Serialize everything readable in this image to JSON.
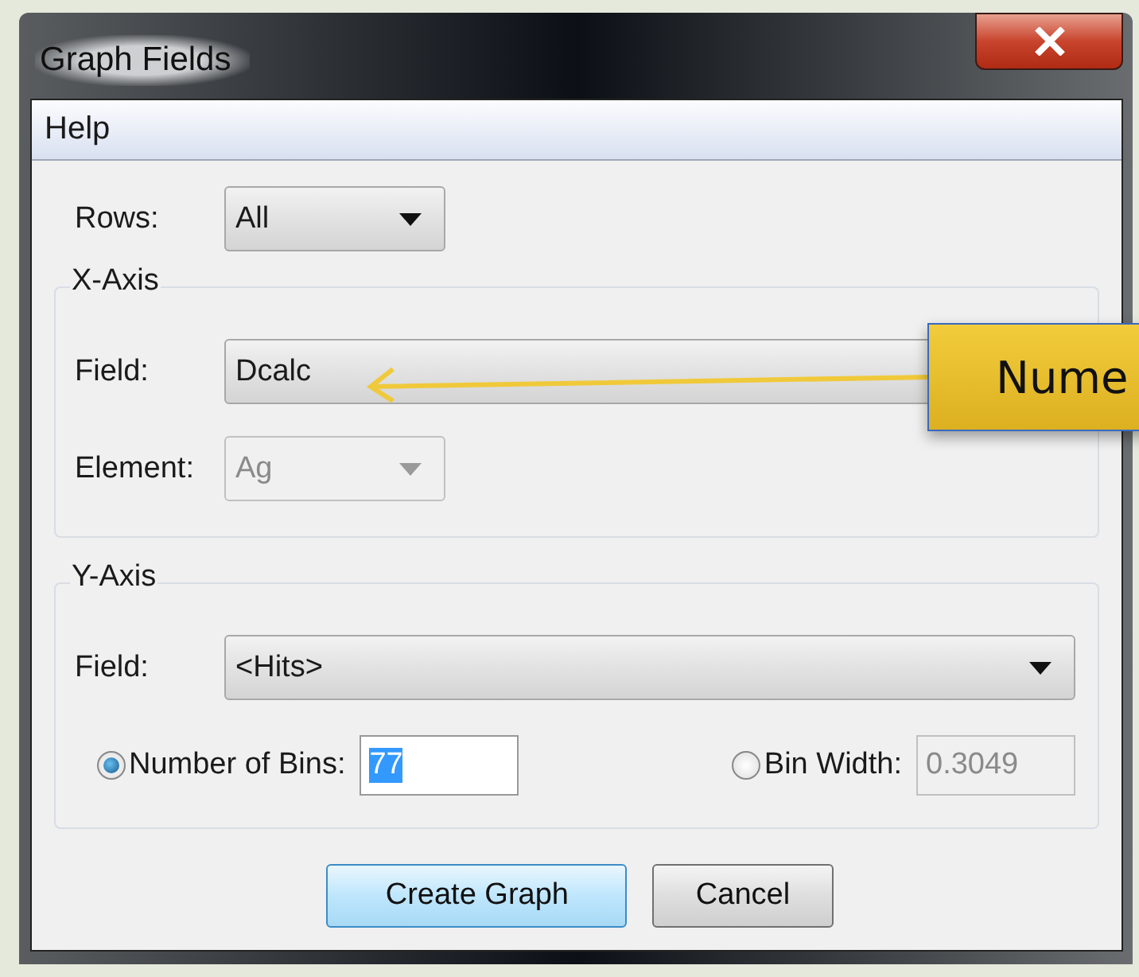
{
  "window": {
    "title": "Graph Fields"
  },
  "menu": [
    {
      "label": "Help"
    }
  ],
  "rows": {
    "label": "Rows:",
    "value": "All"
  },
  "x_axis": {
    "title": "X-Axis",
    "field": {
      "label": "Field:",
      "value": "Dcalc"
    },
    "element": {
      "label": "Element:",
      "value": "Ag",
      "disabled": true
    }
  },
  "y_axis": {
    "title": "Y-Axis",
    "field": {
      "label": "Field:",
      "value": "<Hits>"
    },
    "bin_modes": [
      {
        "label": "Number of Bins:",
        "value": "77",
        "selected": true
      },
      {
        "label": "Bin Width:",
        "value": "0.3049",
        "selected": false
      }
    ]
  },
  "buttons": [
    {
      "label": "Create Graph",
      "default": true
    },
    {
      "label": "Cancel",
      "default": false
    }
  ],
  "callout": {
    "text": "Nume"
  }
}
